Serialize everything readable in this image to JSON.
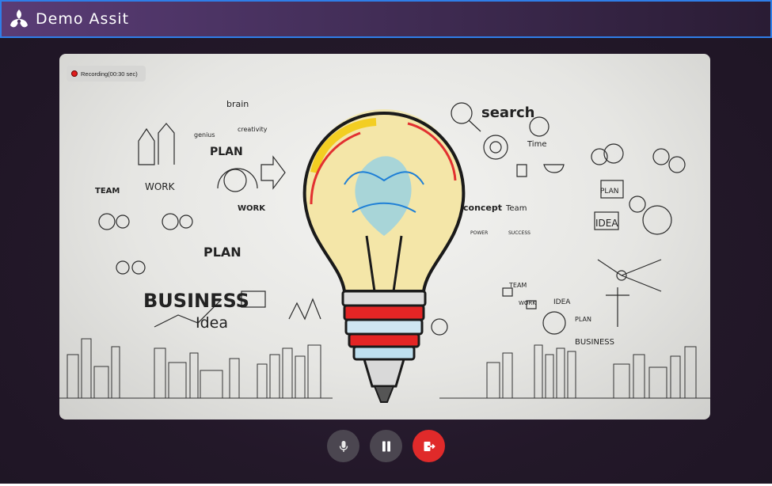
{
  "header": {
    "app_title": "Demo Assit",
    "logo_icon": "tri-petal-logo-icon",
    "border_color": "#2f7ee8"
  },
  "video": {
    "recording_label": "Recording(00:30 sec)",
    "recording_color": "#e01c1c",
    "sketch_words": {
      "brain": "brain",
      "genius": "genius",
      "creativity": "creativity",
      "plan": "PLAN",
      "team": "TEAM",
      "work": "WORK",
      "work2": "WORK",
      "plan2": "PLAN",
      "business": "BUSINESS",
      "idea": "Idea",
      "search": "search",
      "time": "Time",
      "concept": "concept",
      "team2": "Team",
      "power": "POWER",
      "success": "SUCCESS",
      "plan3": "PLAN",
      "idea2": "IDEA",
      "team3": "TEAM",
      "work3": "WORK",
      "idea3": "IDEA",
      "plan4": "PLAN",
      "business2": "BUSINESS"
    }
  },
  "controls": {
    "mic_icon": "microphone-icon",
    "pause_icon": "pause-icon",
    "end_icon": "exit-icon",
    "end_color": "#e02a2a"
  }
}
